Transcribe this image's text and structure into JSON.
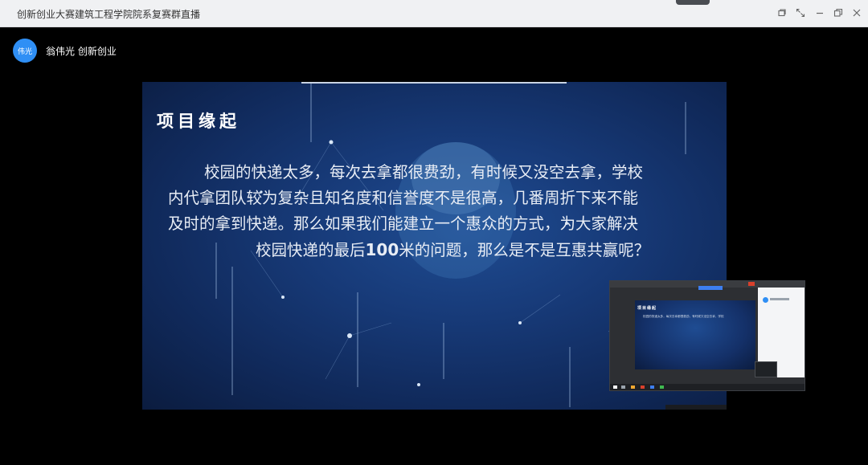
{
  "window": {
    "title": "创新创业大赛建筑工程学院院系复赛群直播"
  },
  "window_controls": [
    "restore-small-icon",
    "fullscreen-icon",
    "minimize-icon",
    "maximize-icon",
    "close-icon"
  ],
  "presenter": {
    "avatar_text": "伟光",
    "name": "翁伟光 创新创业"
  },
  "slide": {
    "title": "项目缘起",
    "body_lines": [
      "校园的快递太多，每次去拿都很费劲，有时候又没空去拿，学校",
      "内代拿团队较为复杂且知名度和信誉度不是很高，几番周折下来不能",
      "及时的拿到快递。那么如果我们能建立一个惠众的方式，为大家解决"
    ],
    "last_line_before": "校园快递的最后",
    "last_line_highlight": "100",
    "last_line_after": "米的问题，那么是不是互惠共赢呢？"
  },
  "colors": {
    "accent": "#2f8ff5",
    "slide_bg": "#173a78",
    "background": "#000000"
  }
}
